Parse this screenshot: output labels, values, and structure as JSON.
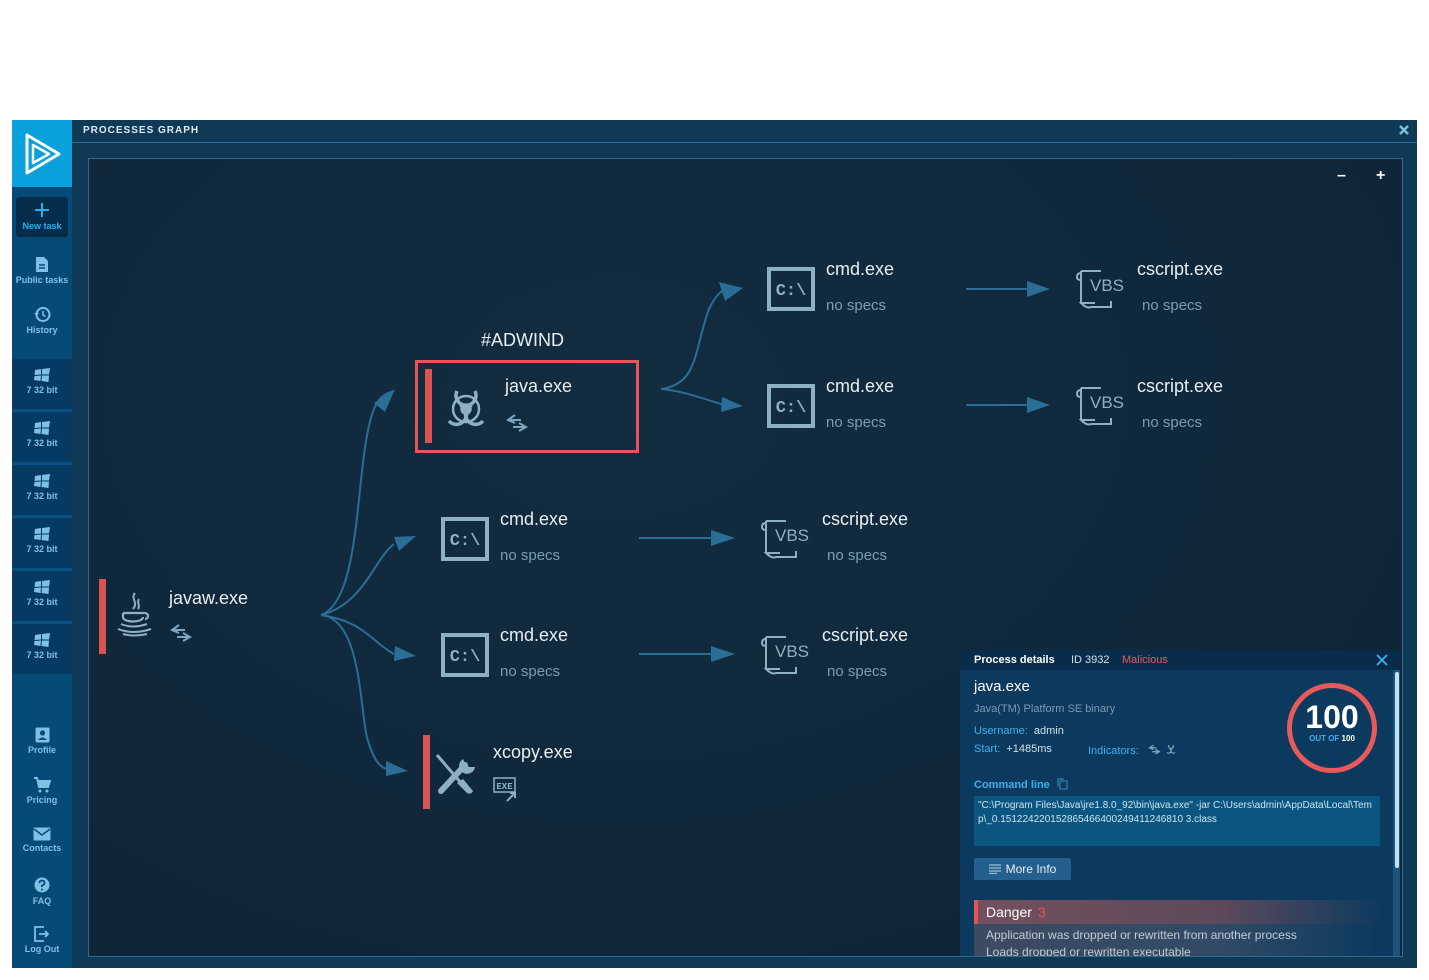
{
  "window": {
    "title": "PROCESSES GRAPH",
    "close_icon": "close-icon"
  },
  "sidebar": {
    "new_task": "New task",
    "items_top": [
      {
        "label": "Public tasks",
        "icon": "document-icon"
      },
      {
        "label": "History",
        "icon": "history-icon"
      }
    ],
    "os_items": [
      {
        "label": "7 32 bit",
        "icon": "windows-icon"
      },
      {
        "label": "7 32 bit",
        "icon": "windows-icon"
      },
      {
        "label": "7 32 bit",
        "icon": "windows-icon"
      },
      {
        "label": "7 32 bit",
        "icon": "windows-icon"
      },
      {
        "label": "7 32 bit",
        "icon": "windows-icon"
      },
      {
        "label": "7 32 bit",
        "icon": "windows-icon"
      }
    ],
    "items_bottom": [
      {
        "label": "Profile",
        "icon": "profile-icon"
      },
      {
        "label": "Pricing",
        "icon": "cart-icon"
      },
      {
        "label": "Contacts",
        "icon": "mail-icon"
      },
      {
        "label": "FAQ",
        "icon": "question-icon"
      },
      {
        "label": "Log Out",
        "icon": "logout-icon"
      }
    ]
  },
  "graph": {
    "zoom_out": "–",
    "zoom_in": "+",
    "nodes": {
      "javaw": {
        "name": "javaw.exe",
        "icon": "java-icon",
        "indicator": "network-arrows-icon",
        "danger": true
      },
      "java": {
        "name": "java.exe",
        "tag": "#ADWIND",
        "icon": "biohazard-icon",
        "indicator": "network-arrows-icon",
        "danger": true,
        "selected": true
      },
      "cmd1": {
        "name": "cmd.exe",
        "spec": "no specs",
        "icon": "cmd-icon"
      },
      "cmd2": {
        "name": "cmd.exe",
        "spec": "no specs",
        "icon": "cmd-icon"
      },
      "cmd3": {
        "name": "cmd.exe",
        "spec": "no specs",
        "icon": "cmd-icon"
      },
      "cmd4": {
        "name": "cmd.exe",
        "spec": "no specs",
        "icon": "cmd-icon"
      },
      "cs1": {
        "name": "cscript.exe",
        "spec": "no specs",
        "icon": "vbs-icon"
      },
      "cs2": {
        "name": "cscript.exe",
        "spec": "no specs",
        "icon": "vbs-icon"
      },
      "cs3": {
        "name": "cscript.exe",
        "spec": "no specs",
        "icon": "vbs-icon"
      },
      "cs4": {
        "name": "cscript.exe",
        "spec": "no specs",
        "icon": "vbs-icon"
      },
      "xcopy": {
        "name": "xcopy.exe",
        "icon": "tools-icon",
        "indicator": "exe-drop-icon",
        "danger": true
      }
    }
  },
  "details": {
    "header": "Process details",
    "id": "ID 3932",
    "verdict": "Malicious",
    "process_name": "java.exe",
    "description": "Java(TM) Platform SE binary",
    "username_label": "Username:",
    "username": "admin",
    "start_label": "Start:",
    "start": "+1485ms",
    "indicators_label": "Indicators:",
    "score": "100",
    "score_out_of_label": "OUT OF",
    "score_max": "100",
    "command_line_label": "Command line",
    "command_line": "\"C:\\Program Files\\Java\\jre1.8.0_92\\bin\\java.exe\" -jar C:\\Users\\admin\\AppData\\Local\\Temp\\_0.151224220152865466400249411246810 3.class",
    "more_info": "More Info",
    "danger_label": "Danger",
    "danger_count": "3",
    "danger_items": [
      "Application was dropped or rewritten from another process",
      "Loads dropped or rewritten executable"
    ],
    "colors": {
      "malicious": "#e85a5a",
      "accent": "#3fb0ee"
    }
  }
}
